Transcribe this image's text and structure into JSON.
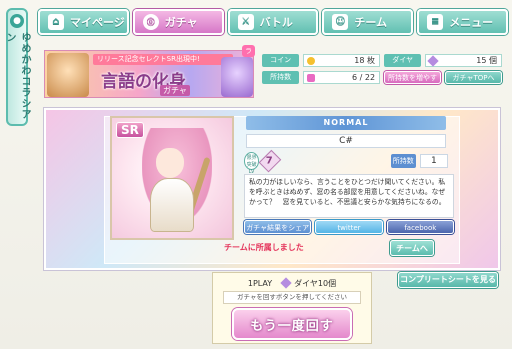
{
  "side_tab": {
    "label": "ゆめかわコラシアン"
  },
  "nav": {
    "items": [
      {
        "label": "マイページ",
        "icon": "home-icon",
        "glyph": "⌂"
      },
      {
        "label": "ガチャ",
        "icon": "gacha-icon",
        "glyph": "◎"
      },
      {
        "label": "バトル",
        "icon": "battle-icon",
        "glyph": "⚔"
      },
      {
        "label": "チーム",
        "icon": "team-icon",
        "glyph": "☺"
      },
      {
        "label": "メニュー",
        "icon": "menu-icon",
        "glyph": "≡"
      }
    ],
    "active": "ガチャ"
  },
  "banner": {
    "ribbon": "リリース記念セレクトSR出現中!",
    "title": "言語の化身",
    "sub": "ガチャ",
    "badge": "ラ"
  },
  "resources": {
    "coin_label": "コイン",
    "coin_value": "18 枚",
    "diamond_label": "ダイヤ",
    "diamond_value": "15 個",
    "cards_label": "所持数",
    "cards_value": "6 / 22",
    "expand_button": "所持数を増やす",
    "gacha_top_button": "ガチャTOPへ"
  },
  "card": {
    "rarity_badge": "SR",
    "rarity_label": "NORMAL",
    "name": "C#",
    "limit_label": "限界突破 LV",
    "limit_value": "7",
    "owned_label": "所持数",
    "owned_value": "1",
    "description": "私の力がほしいなら、言うことをひとつだけ聞いてください。私を呼ぶときはぬめず、窓の名る部屋を用意してくださいね。なぜかって？　窓を見ていると、不思議と安らかな気持ちになるの。"
  },
  "share": {
    "gacha_share": "ガチャ結果をシェア",
    "twitter": "twitter",
    "facebook": "facebook"
  },
  "team": {
    "message": "チームに所属しました",
    "button": "チームへ"
  },
  "bottom": {
    "play_label": "1PLAY",
    "cost_label": "ダイヤ10個",
    "hint": "ガチャを回すボタンを押してください",
    "again_button": "もう一度回す"
  },
  "complete_button": "コンプリートシートを見る",
  "colors": {
    "teal": "#5fc0b2",
    "pink": "#d678c7",
    "blue": "#5d8fd1",
    "alert_red": "#e4325a"
  }
}
